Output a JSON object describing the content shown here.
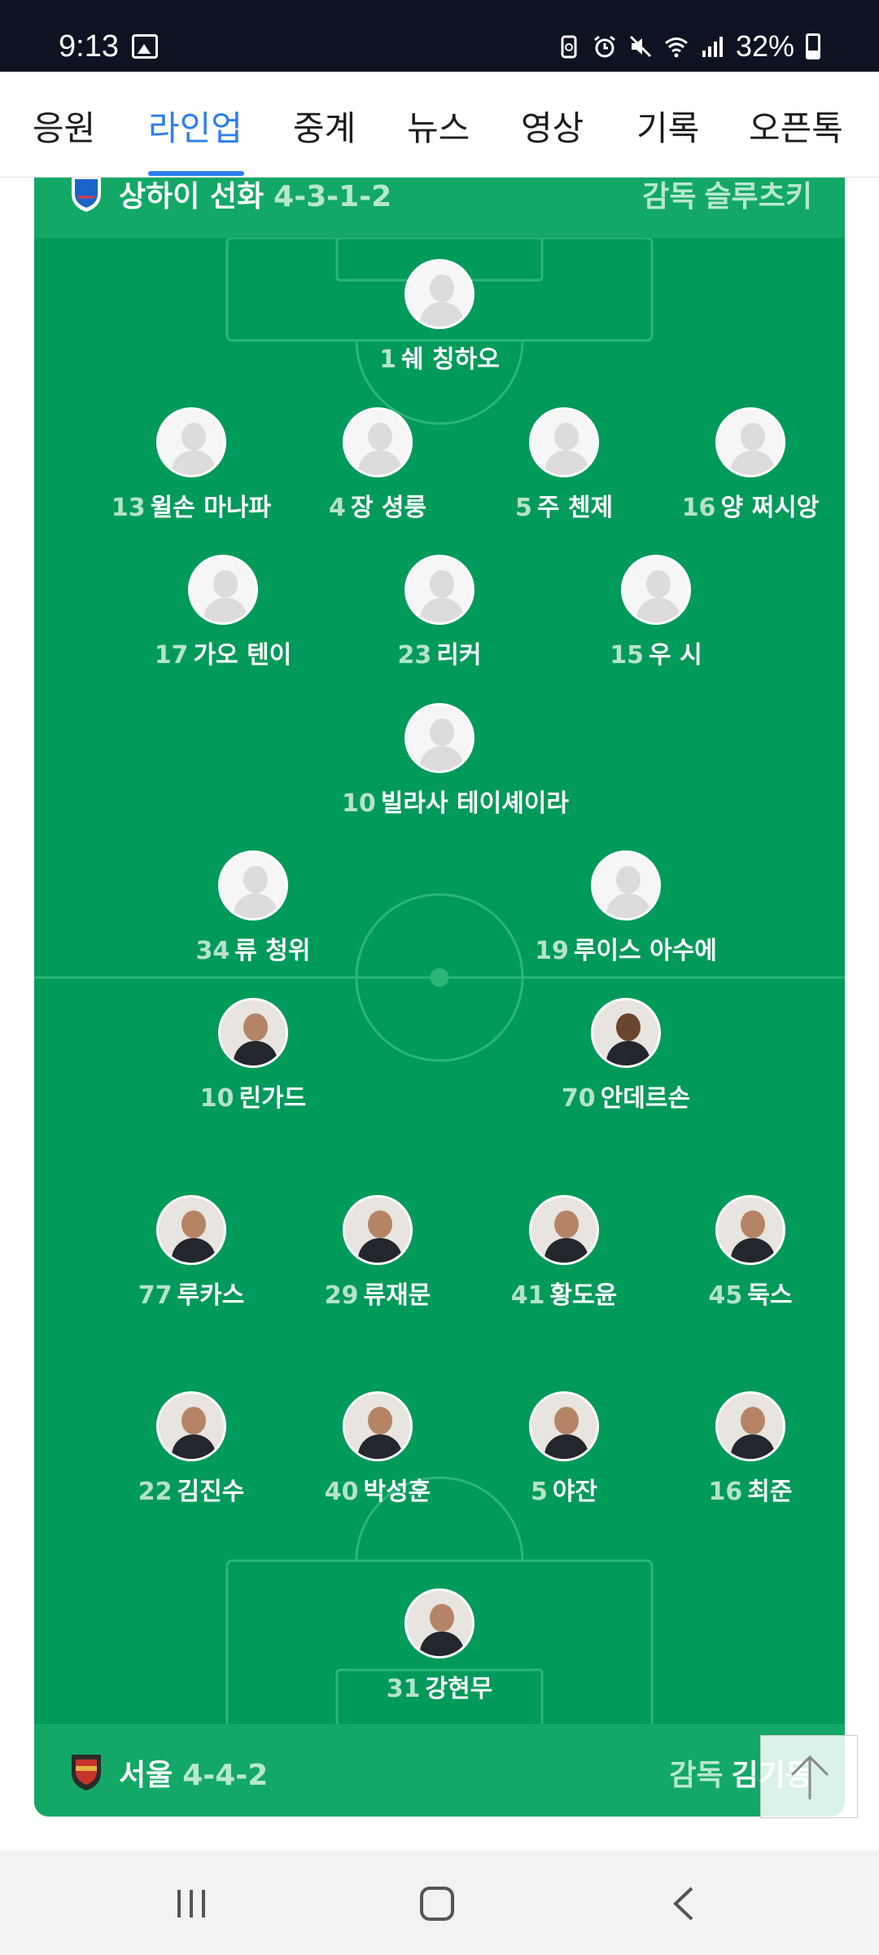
{
  "status": {
    "time": "9:13",
    "battery": "32%"
  },
  "tabs": [
    {
      "label": "응원"
    },
    {
      "label": "라인업"
    },
    {
      "label": "중계"
    },
    {
      "label": "뉴스"
    },
    {
      "label": "영상"
    },
    {
      "label": "기록"
    },
    {
      "label": "오픈톡"
    }
  ],
  "home": {
    "name": "상하이 선화",
    "formation": "4-3-1-2",
    "coach_label": "감독",
    "coach": "슬루츠키",
    "players": [
      {
        "num": "1",
        "name": "쉐 칭하오"
      },
      {
        "num": "13",
        "name": "윌손 마나파"
      },
      {
        "num": "4",
        "name": "장 셩룽"
      },
      {
        "num": "5",
        "name": "주 첸제"
      },
      {
        "num": "16",
        "name": "양 쩌시앙"
      },
      {
        "num": "17",
        "name": "가오 텐이"
      },
      {
        "num": "23",
        "name": "리커"
      },
      {
        "num": "15",
        "name": "우 시"
      },
      {
        "num": "10",
        "name": "빌라사 테이셰이라"
      },
      {
        "num": "34",
        "name": "류 청위"
      },
      {
        "num": "19",
        "name": "루이스 아수에"
      }
    ]
  },
  "away": {
    "name": "서울",
    "formation": "4-4-2",
    "coach_label": "감독",
    "coach": "김기동",
    "players": [
      {
        "num": "10",
        "name": "린가드"
      },
      {
        "num": "70",
        "name": "안데르손"
      },
      {
        "num": "77",
        "name": "루카스"
      },
      {
        "num": "29",
        "name": "류재문"
      },
      {
        "num": "41",
        "name": "황도윤"
      },
      {
        "num": "45",
        "name": "둑스"
      },
      {
        "num": "22",
        "name": "김진수"
      },
      {
        "num": "40",
        "name": "박성훈"
      },
      {
        "num": "5",
        "name": "야잔"
      },
      {
        "num": "16",
        "name": "최준"
      },
      {
        "num": "31",
        "name": "강현무"
      }
    ]
  },
  "icons": {
    "status_left": [
      "image-icon"
    ],
    "status_right": [
      "battery-saver-icon",
      "alarm-icon",
      "mute-icon",
      "wifi-icon",
      "signal-icon",
      "battery-icon"
    ],
    "scroll_top": "arrow-up-icon",
    "nav": [
      "recents-icon",
      "home-icon",
      "back-icon"
    ]
  }
}
